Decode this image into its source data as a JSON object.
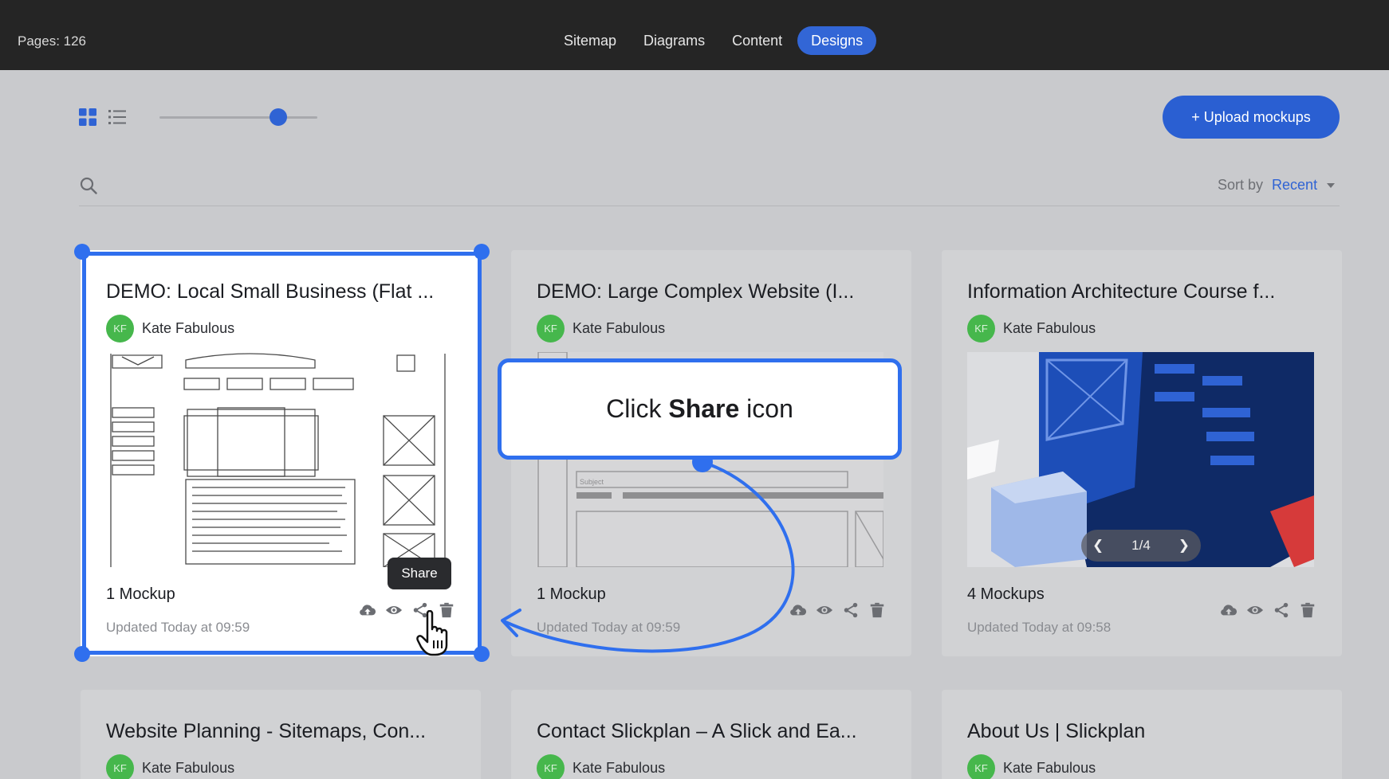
{
  "topbar": {
    "pages_label": "Pages: 126",
    "tabs": [
      {
        "label": "Sitemap",
        "active": false
      },
      {
        "label": "Diagrams",
        "active": false
      },
      {
        "label": "Content",
        "active": false
      },
      {
        "label": "Designs",
        "active": true
      }
    ]
  },
  "toolbar": {
    "view_options": [
      "grid-view-icon",
      "list-view-icon"
    ],
    "active_view": "grid",
    "zoom_slider_value": 0.75,
    "upload_label": "+ Upload mockups"
  },
  "filter": {
    "sort_by_label": "Sort by",
    "sort_value": "Recent"
  },
  "cards": [
    {
      "title": "DEMO: Local Small Business (Flat ...",
      "avatar": "KF",
      "author": "Kate Fabulous",
      "mockups": "1 Mockup",
      "updated": "Updated Today at 09:59"
    },
    {
      "title": "DEMO: Large Complex Website (I...",
      "avatar": "KF",
      "author": "Kate Fabulous",
      "mockups": "1 Mockup",
      "updated": "Updated Today at 09:59"
    },
    {
      "title": "Information Architecture Course f...",
      "avatar": "KF",
      "author": "Kate Fabulous",
      "mockups": "4 Mockups",
      "updated": "Updated Today at 09:58",
      "pager": "1/4"
    },
    {
      "title": "Website Planning - Sitemaps, Con...",
      "avatar": "KF",
      "author": "Kate Fabulous"
    },
    {
      "title": "Contact Slickplan – A Slick and Ea...",
      "avatar": "KF",
      "author": "Kate Fabulous"
    },
    {
      "title": "About Us | Slickplan",
      "avatar": "KF",
      "author": "Kate Fabulous"
    }
  ],
  "tooltip": "Share",
  "callout": {
    "pre": "Click ",
    "bold": "Share",
    "post": " icon"
  },
  "colors": {
    "accent": "#2f6fee",
    "topbar": "#252525",
    "avatar": "#46b74c",
    "primary_button": "#2a5fd2"
  }
}
